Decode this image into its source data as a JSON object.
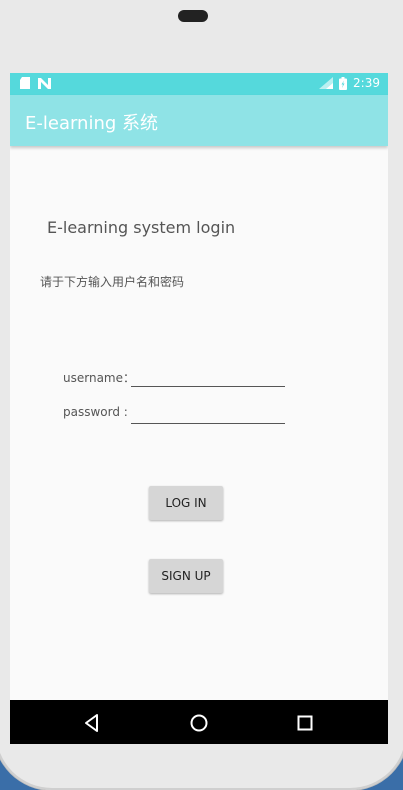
{
  "status": {
    "time": "2:39",
    "left_icons": [
      "sd-card-icon",
      "n-notification-icon"
    ],
    "right_icons": [
      "signal-icon",
      "battery-icon"
    ]
  },
  "appbar": {
    "title": "E-learning 系统"
  },
  "content": {
    "heading": "E-learning system login",
    "instruction": "请于下方输入用户名和密码",
    "username_label": "username：",
    "username_value": "",
    "password_label": "password :",
    "password_value": "",
    "login_label": "LOG IN",
    "signup_label": "SIGN UP"
  },
  "colors": {
    "status_bar": "#55d9dc",
    "app_bar": "#8fe3e6",
    "button": "#d6d6d6",
    "nav_bar": "#000000"
  }
}
